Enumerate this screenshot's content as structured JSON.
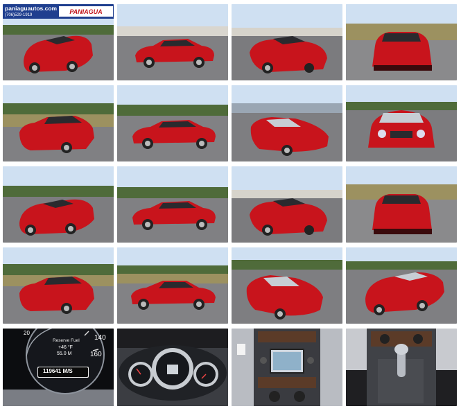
{
  "banner": {
    "site": "paniaguautos.com",
    "phone": "(706)529-1919",
    "brand": "PANIAGUA"
  },
  "odometer": {
    "gauge_140": "140",
    "gauge_160": "160",
    "gauge_20": "20",
    "warning": "Reserve Fuel",
    "temp": "+46 °F",
    "trip": "55.0 M",
    "total": "119641 M/S"
  },
  "photos": [
    {
      "view": "front-left 3/4, top down"
    },
    {
      "view": "side profile left, top up"
    },
    {
      "view": "rear-right 3/4, top up"
    },
    {
      "view": "rear, top up"
    },
    {
      "view": "rear-left 3/4, top up"
    },
    {
      "view": "side profile left, top up"
    },
    {
      "view": "front-right 3/4, top down"
    },
    {
      "view": "front, top down"
    },
    {
      "view": "front-left 3/4, top down"
    },
    {
      "view": "side profile left, top up"
    },
    {
      "view": "rear-right 3/4, top up"
    },
    {
      "view": "rear, top up"
    },
    {
      "view": "rear-left 3/4, top up"
    },
    {
      "view": "side profile right, top up"
    },
    {
      "view": "front-right 3/4, top down"
    },
    {
      "view": "front-left 3/4, top down"
    },
    {
      "view": "odometer close-up"
    },
    {
      "view": "instrument cluster"
    },
    {
      "view": "center console navigation"
    },
    {
      "view": "automatic gear shifter"
    }
  ],
  "colors": {
    "car_red": "#c8141c",
    "sky": "#cfe0f2",
    "asphalt": "#7d7d80",
    "grass": "#9c9160"
  }
}
